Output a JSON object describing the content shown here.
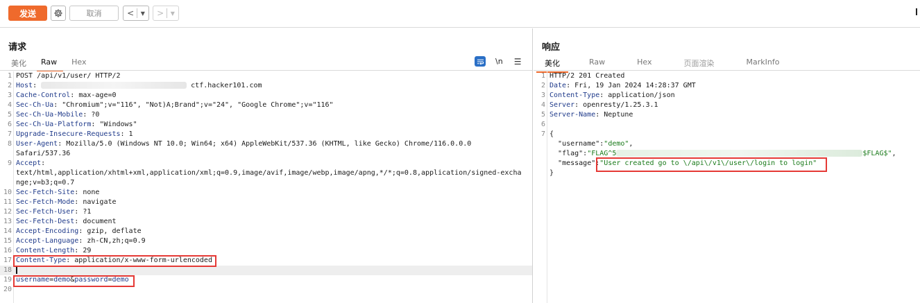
{
  "toolbar": {
    "send_label": "发送",
    "cancel_label": "取消",
    "back_glyph": "<",
    "forward_glyph": ">",
    "dropdown_glyph": "▼"
  },
  "request": {
    "title": "请求",
    "tabs": [
      "美化",
      "Raw",
      "Hex"
    ],
    "active_tab": "Raw",
    "newline_label": "\\n",
    "lines": [
      {
        "n": "1",
        "k": "",
        "v": "POST /api/v1/user/ HTTP/2"
      },
      {
        "n": "2",
        "k": "Host",
        "v": " ctf.hacker101.com",
        "blur": true
      },
      {
        "n": "3",
        "k": "Cache-Control",
        "v": ": max-age=0"
      },
      {
        "n": "4",
        "k": "Sec-Ch-Ua",
        "v": ": \"Chromium\";v=\"116\", \"Not)A;Brand\";v=\"24\", \"Google Chrome\";v=\"116\""
      },
      {
        "n": "5",
        "k": "Sec-Ch-Ua-Mobile",
        "v": ": ?0"
      },
      {
        "n": "6",
        "k": "Sec-Ch-Ua-Platform",
        "v": ": \"Windows\""
      },
      {
        "n": "7",
        "k": "Upgrade-Insecure-Requests",
        "v": ": 1"
      },
      {
        "n": "8",
        "k": "User-Agent",
        "v": ": Mozilla/5.0 (Windows NT 10.0; Win64; x64) AppleWebKit/537.36 (KHTML, like Gecko) Chrome/116.0.0.0"
      },
      {
        "n": "",
        "k": "",
        "v": "Safari/537.36"
      },
      {
        "n": "9",
        "k": "Accept",
        "v": ":"
      },
      {
        "n": "",
        "k": "",
        "v": "text/html,application/xhtml+xml,application/xml;q=0.9,image/avif,image/webp,image/apng,*/*;q=0.8,application/signed-excha"
      },
      {
        "n": "",
        "k": "",
        "v": "nge;v=b3;q=0.7"
      },
      {
        "n": "10",
        "k": "Sec-Fetch-Site",
        "v": ": none"
      },
      {
        "n": "11",
        "k": "Sec-Fetch-Mode",
        "v": ": navigate"
      },
      {
        "n": "12",
        "k": "Sec-Fetch-User",
        "v": ": ?1"
      },
      {
        "n": "13",
        "k": "Sec-Fetch-Dest",
        "v": ": document"
      },
      {
        "n": "14",
        "k": "Accept-Encoding",
        "v": ": gzip, deflate"
      },
      {
        "n": "15",
        "k": "Accept-Language",
        "v": ": zh-CN,zh;q=0.9"
      },
      {
        "n": "16",
        "k": "Content-Length",
        "v": ": 29"
      },
      {
        "n": "17",
        "k": "Content-Type",
        "v": ": application/x-www-form-urlencoded"
      },
      {
        "n": "18",
        "k": "",
        "v": "",
        "cursor": true
      },
      {
        "n": "19",
        "k": "",
        "v": "",
        "body": true
      },
      {
        "n": "20",
        "k": "",
        "v": ""
      }
    ],
    "body": {
      "k1": "username",
      "v1": "demo",
      "amp": "&",
      "k2": "password",
      "v2": "demo",
      "eq": "="
    }
  },
  "response": {
    "title": "响应",
    "tabs": [
      "美化",
      "Raw",
      "Hex",
      "页面渲染",
      "MarkInfo"
    ],
    "active_tab": "美化",
    "lines": [
      {
        "n": "1",
        "k": "",
        "v": "HTTP/2 201 Created"
      },
      {
        "n": "2",
        "k": "Date",
        "v": ": Fri, 19 Jan 2024 14:28:37 GMT"
      },
      {
        "n": "3",
        "k": "Content-Type",
        "v": ": application/json"
      },
      {
        "n": "4",
        "k": "Server",
        "v": ": openresty/1.25.3.1"
      },
      {
        "n": "5",
        "k": "Server-Name",
        "v": ": Neptune"
      },
      {
        "n": "6",
        "k": "",
        "v": ""
      },
      {
        "n": "7",
        "k": "",
        "v": "{"
      },
      {
        "n": "",
        "k": "",
        "v": "",
        "json": "username"
      },
      {
        "n": "",
        "k": "",
        "v": "",
        "json": "flag"
      },
      {
        "n": "",
        "k": "",
        "v": "",
        "json": "message"
      },
      {
        "n": "",
        "k": "",
        "v": "}"
      }
    ],
    "json": {
      "username_key": "\"username\"",
      "username_val": "\"demo\"",
      "flag_key": "\"flag\"",
      "flag_start": "\"FLAG^5",
      "flag_end": "$FLAG$\"",
      "message_key": "\"message\"",
      "message_val": "\"User created go to \\/api\\/v1\\/user\\/login to login\""
    }
  }
}
